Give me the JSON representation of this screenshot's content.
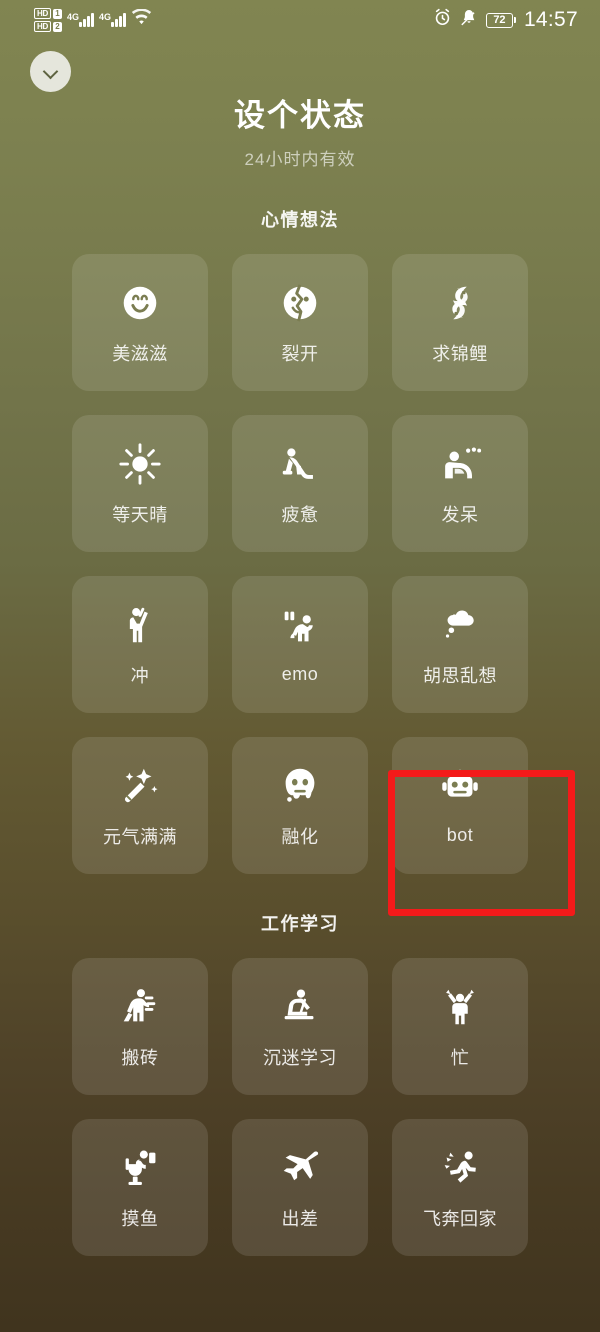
{
  "statusbar": {
    "sim1_label": "HD",
    "sim1_num": "1",
    "sim2_label": "HD",
    "sim2_num": "2",
    "network1": "4G",
    "network2": "4G",
    "wifi_icon": "wifi-icon",
    "alarm_icon": "alarm-clock-icon",
    "mute_icon": "bell-muted-icon",
    "battery_percent": "72",
    "time": "14:57"
  },
  "header": {
    "collapse_icon": "chevron-down-icon",
    "title": "设个状态",
    "subtitle": "24小时内有效"
  },
  "sections": [
    {
      "title": "心情想法",
      "tiles": [
        {
          "label": "美滋滋",
          "icon": "smiling-face-icon"
        },
        {
          "label": "裂开",
          "icon": "cracked-face-icon"
        },
        {
          "label": "求锦鲤",
          "icon": "koi-fish-icon"
        },
        {
          "label": "等天晴",
          "icon": "sun-icon"
        },
        {
          "label": "疲惫",
          "icon": "tired-person-icon"
        },
        {
          "label": "发呆",
          "icon": "daydreaming-person-icon"
        },
        {
          "label": "冲",
          "icon": "cheering-person-icon"
        },
        {
          "label": "emo",
          "icon": "crouching-person-icon"
        },
        {
          "label": "胡思乱想",
          "icon": "thought-cloud-icon"
        },
        {
          "label": "元气满满",
          "icon": "magic-wand-sparkle-icon"
        },
        {
          "label": "融化",
          "icon": "melting-face-icon"
        },
        {
          "label": "bot",
          "icon": "robot-icon"
        }
      ]
    },
    {
      "title": "工作学习",
      "tiles": [
        {
          "label": "搬砖",
          "icon": "carrying-bricks-icon"
        },
        {
          "label": "沉迷学习",
          "icon": "studying-desk-icon"
        },
        {
          "label": "忙",
          "icon": "busy-person-icon"
        },
        {
          "label": "摸鱼",
          "icon": "toilet-phone-icon"
        },
        {
          "label": "出差",
          "icon": "airplane-icon"
        },
        {
          "label": "飞奔回家",
          "icon": "running-person-icon"
        }
      ]
    }
  ],
  "annotation": {
    "target_label": "bot",
    "color": "#f41a1a"
  }
}
